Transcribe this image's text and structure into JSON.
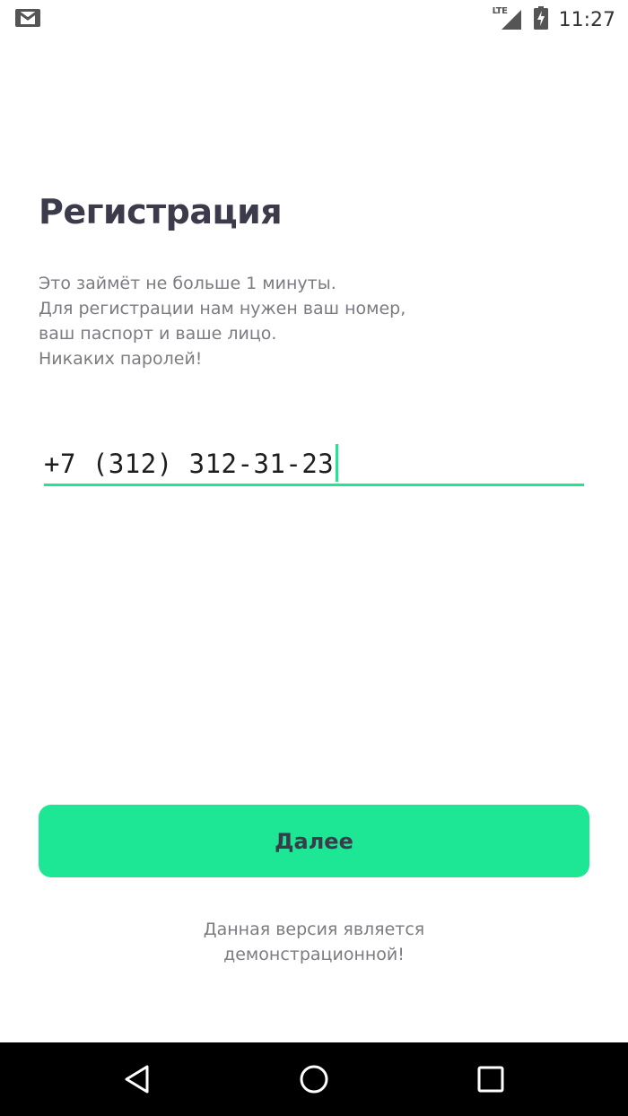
{
  "status_bar": {
    "network_label": "LTE",
    "time": "11:27",
    "notification_icon": "gmail-icon",
    "signal_icon": "cell-signal-icon",
    "battery_icon": "battery-charging-icon"
  },
  "header": {
    "title": "Регистрация"
  },
  "description": {
    "lines": [
      "Это займёт не больше 1 минуты.",
      "Для регистрации нам нужен ваш номер,",
      "ваш паспорт и ваше лицо.",
      "Никаких паролей!"
    ]
  },
  "phone": {
    "value": "+7 (312) 312-31-23"
  },
  "actions": {
    "next_label": "Далее"
  },
  "footer": {
    "lines": [
      "Данная версия является",
      "демонстрационной!"
    ]
  },
  "colors": {
    "accent": "#1de694",
    "title": "#3c3b4b",
    "muted_text": "#7b7b82",
    "nav_bar": "#000000"
  },
  "nav_bar": {
    "back_icon": "back-triangle-icon",
    "home_icon": "home-circle-icon",
    "recents_icon": "recents-square-icon"
  }
}
